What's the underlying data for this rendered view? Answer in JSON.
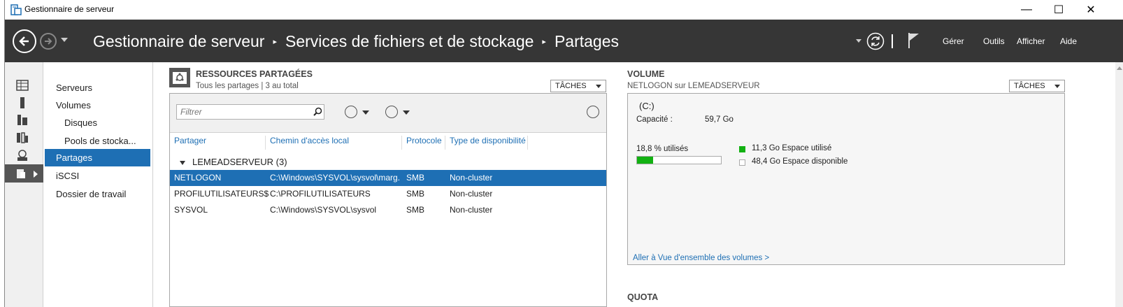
{
  "window": {
    "title": "Gestionnaire de serveur",
    "controls": {
      "minimize": "—",
      "maximize": "☐",
      "close": "✕"
    }
  },
  "header": {
    "breadcrumb": [
      "Gestionnaire de serveur",
      "Services de fichiers et de stockage",
      "Partages"
    ],
    "separator": "▸",
    "menu": [
      "Gérer",
      "Outils",
      "Afficher",
      "Aide"
    ],
    "icons": [
      "back-icon",
      "forward-icon",
      "refresh-icon",
      "flag-icon"
    ]
  },
  "sidebar": {
    "icons": [
      "dashboard-icon",
      "local-server-icon",
      "all-servers-icon",
      "roles-icon",
      "server-role-icon",
      "file-storage-icon"
    ],
    "items": [
      {
        "label": "Serveurs",
        "sub": false,
        "active": false
      },
      {
        "label": "Volumes",
        "sub": false,
        "active": false
      },
      {
        "label": "Disques",
        "sub": true,
        "active": false
      },
      {
        "label": "Pools de stocka...",
        "sub": true,
        "active": false
      },
      {
        "label": "Partages",
        "sub": false,
        "active": true
      },
      {
        "label": "iSCSI",
        "sub": false,
        "active": false
      },
      {
        "label": "Dossier de travail",
        "sub": false,
        "active": false
      }
    ]
  },
  "shares": {
    "title": "RESSOURCES PARTAGÉES",
    "subtitle": "Tous les partages | 3 au total",
    "tasks_label": "TÂCHES",
    "filter_placeholder": "Filtrer",
    "columns": [
      "Partager",
      "Chemin d'accès local",
      "Protocole",
      "Type de disponibilité"
    ],
    "group": "LEMEADSERVEUR (3)",
    "rows": [
      {
        "name": "NETLOGON",
        "path": "C:\\Windows\\SYSVOL\\sysvol\\marg...",
        "protocol": "SMB",
        "availability": "Non-cluster",
        "selected": true
      },
      {
        "name": "PROFILUTILISATEURS$",
        "path": "C:\\PROFILUTILISATEURS",
        "protocol": "SMB",
        "availability": "Non-cluster",
        "selected": false
      },
      {
        "name": "SYSVOL",
        "path": "C:\\Windows\\SYSVOL\\sysvol",
        "protocol": "SMB",
        "availability": "Non-cluster",
        "selected": false
      }
    ]
  },
  "volume": {
    "title": "VOLUME",
    "subtitle": "NETLOGON sur LEMEADSERVEUR",
    "tasks_label": "TÂCHES",
    "drive": "(C:)",
    "capacity_label": "Capacité :",
    "capacity_value": "59,7 Go",
    "used_percent_label": "18,8 % utilisés",
    "used_fraction": 0.188,
    "used_legend": "11,3 Go Espace utilisé",
    "free_legend": "48,4 Go Espace disponible",
    "used_color": "#12b112",
    "link": "Aller à Vue d'ensemble des volumes >"
  },
  "quota": {
    "title": "QUOTA"
  },
  "colors": {
    "accent": "#1e6fb4",
    "header_bg": "#363636"
  }
}
